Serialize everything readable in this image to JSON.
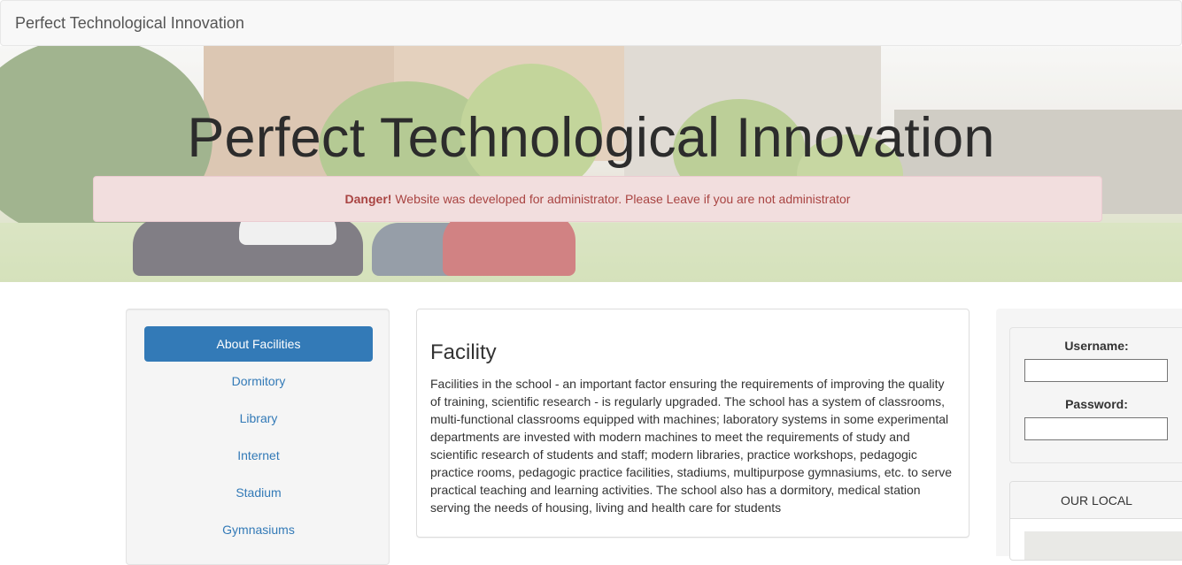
{
  "navbar": {
    "brand": "Perfect Technological Innovation"
  },
  "hero": {
    "title": "Perfect Technological Innovation"
  },
  "alert": {
    "strong": "Danger!",
    "message": " Website was developed for administrator. Please Leave if you are not administrator"
  },
  "sidebar": {
    "items": [
      {
        "label": "About Facilities",
        "active": true
      },
      {
        "label": "Dormitory",
        "active": false
      },
      {
        "label": "Library",
        "active": false
      },
      {
        "label": "Internet",
        "active": false
      },
      {
        "label": "Stadium",
        "active": false
      },
      {
        "label": "Gymnasiums",
        "active": false
      }
    ]
  },
  "content": {
    "title": "Facility",
    "text": "Facilities in the school - an important factor ensuring the requirements of improving the quality of training, scientific research - is regularly upgraded. The school has a system of classrooms, multi-functional classrooms equipped with machines; laboratory systems in some experimental departments are invested with modern machines to meet the requirements of study and scientific research of students and staff; modern libraries, practice workshops, pedagogic practice rooms, pedagogic practice facilities, stadiums, multipurpose gymnasiums, etc. to serve practical teaching and learning activities. The school also has a dormitory, medical station serving the needs of housing, living and health care for students"
  },
  "login": {
    "username_label": "Username:",
    "username_value": "",
    "password_label": "Password:",
    "password_value": ""
  },
  "local": {
    "heading": "OUR LOCAL"
  },
  "colors": {
    "primary": "#337ab7",
    "danger_text": "#a94442",
    "danger_bg": "#f2dede"
  }
}
